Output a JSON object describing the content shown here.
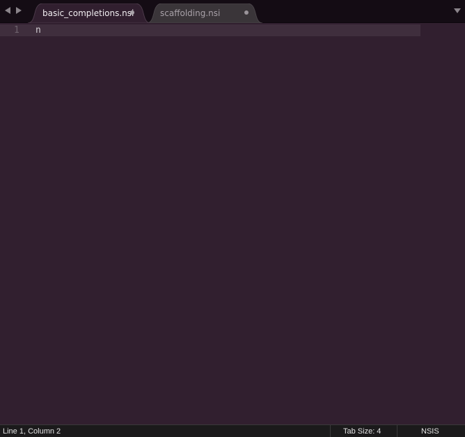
{
  "tabs": [
    {
      "label": "basic_completions.nsi",
      "active": true,
      "dirty": true
    },
    {
      "label": "scaffolding.nsi",
      "active": false,
      "dirty": true
    }
  ],
  "editor": {
    "lines": [
      {
        "number": "1",
        "text": "n"
      }
    ]
  },
  "statusbar": {
    "position": "Line 1, Column 2",
    "tab_size": "Tab Size: 4",
    "syntax": "NSIS"
  },
  "icons": {
    "back": "chevron-left-icon",
    "forward": "chevron-right-icon",
    "dirty": "unsaved-dot-icon",
    "tab_menu": "chevron-down-icon"
  },
  "colors": {
    "background": "#311f2f",
    "current_line": "#3f2e3d",
    "tabbar": "#140c14",
    "active_tab": "#311f2f",
    "inactive_tab": "#3a3539",
    "statusbar": "#1b1a1b"
  }
}
